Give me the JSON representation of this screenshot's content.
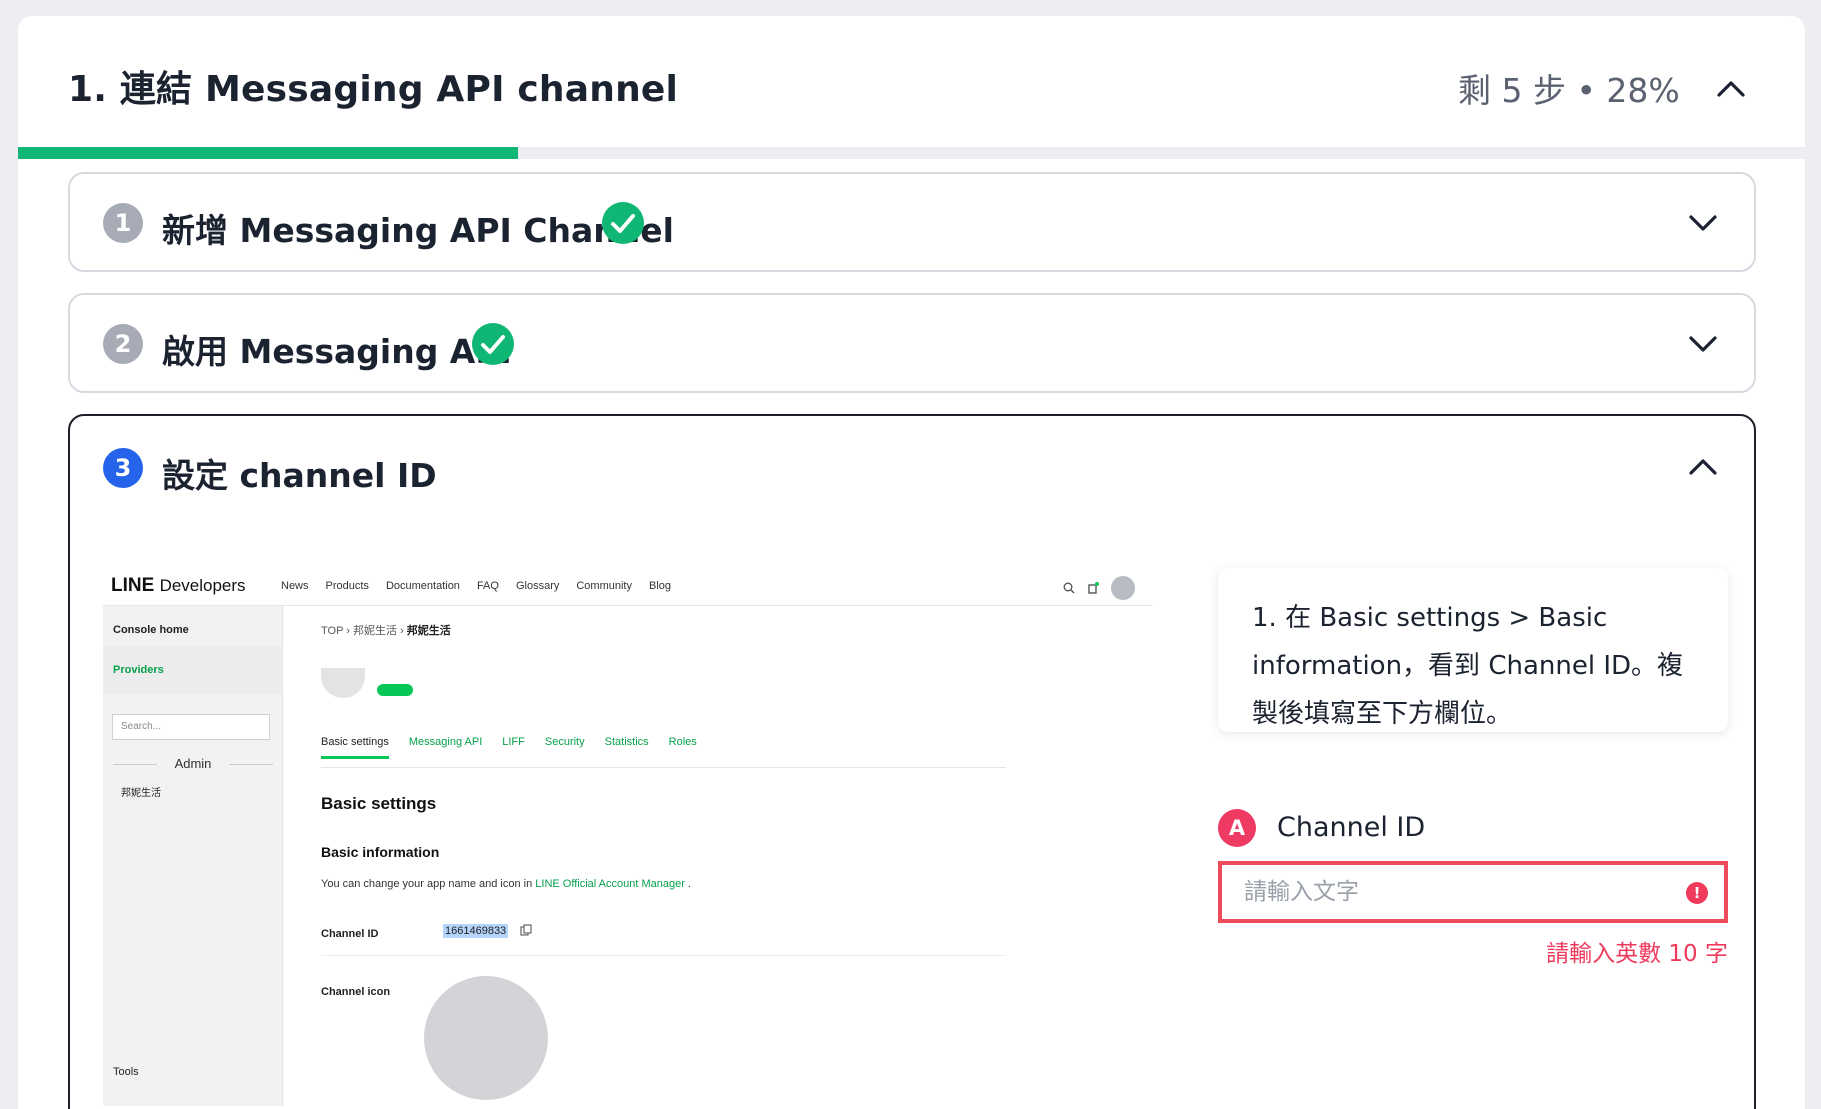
{
  "section": {
    "title": "1. 連結 Messaging API channel",
    "progress_text": "剩 5 步 • 28%",
    "progress_value": 0.28
  },
  "steps": [
    {
      "number": "1",
      "title": "新增 Messaging API Channel",
      "done": true
    },
    {
      "number": "2",
      "title": "啟用 Messaging API",
      "done": true
    },
    {
      "number": "3",
      "title": "設定 channel ID",
      "done": false
    }
  ],
  "screenshot": {
    "logo": "LINE",
    "logo_sub": "Developers",
    "nav_links": [
      "News",
      "Products",
      "Documentation",
      "FAQ",
      "Glossary",
      "Community",
      "Blog"
    ],
    "sidebar": {
      "console_home": "Console home",
      "providers": "Providers",
      "search_placeholder": "Search...",
      "admin": "Admin",
      "provider_item": "邦妮生活",
      "tools": "Tools"
    },
    "breadcrumb": [
      "TOP",
      "邦妮生活",
      "邦妮生活"
    ],
    "tabs": [
      "Basic settings",
      "Messaging API",
      "LIFF",
      "Security",
      "Statistics",
      "Roles"
    ],
    "heading": "Basic settings",
    "subheading": "Basic information",
    "info_text": "You can change your app name and icon in",
    "info_link": "LINE Official Account Manager",
    "channel_id_label": "Channel ID",
    "channel_id_value": "1661469833",
    "channel_icon_label": "Channel icon"
  },
  "instructions": "1. 在 Basic settings > Basic information，看到 Channel ID。複製後填寫至下方欄位。",
  "field": {
    "badge": "A",
    "label": "Channel ID",
    "placeholder": "請輸入文字",
    "value": "",
    "error": "請輸入英數 10 字"
  },
  "colors": {
    "progress": "#10b673",
    "active_step": "#2563eb",
    "check": "#10b673",
    "error": "#ef3a5c",
    "line_green": "#06c755"
  }
}
